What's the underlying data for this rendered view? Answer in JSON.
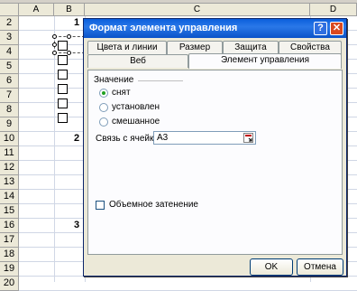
{
  "sheet": {
    "columns": [
      "A",
      "B",
      "C",
      "D"
    ],
    "rows": [
      "2",
      "3",
      "4",
      "5",
      "6",
      "7",
      "8",
      "9",
      "10",
      "11",
      "12",
      "13",
      "14",
      "15",
      "16",
      "17",
      "18",
      "19",
      "20"
    ],
    "group_numbers": {
      "r2": "1",
      "r10": "2",
      "r16": "3"
    }
  },
  "dialog": {
    "title": "Формат элемента управления",
    "help_glyph": "?",
    "close_glyph": "✕",
    "tabs_row1": [
      "Цвета и линии",
      "Размер",
      "Защита",
      "Свойства"
    ],
    "tabs_row2": [
      "Веб",
      "Элемент управления"
    ],
    "active_tab": "Элемент управления",
    "value_group_label": "Значение",
    "radios": [
      "снят",
      "установлен",
      "смешанное"
    ],
    "selected_radio": "снят",
    "cell_link_label": "Связь с ячейкой:",
    "cell_link_value": "A3",
    "shading_label": "Объемное затенение",
    "shading_checked": false,
    "ok_label": "OK",
    "cancel_label": "Отмена"
  },
  "colors": {
    "title_bar": "#0a52c8",
    "close_button": "#d9491f",
    "dialog_bg": "#ece9d8"
  }
}
